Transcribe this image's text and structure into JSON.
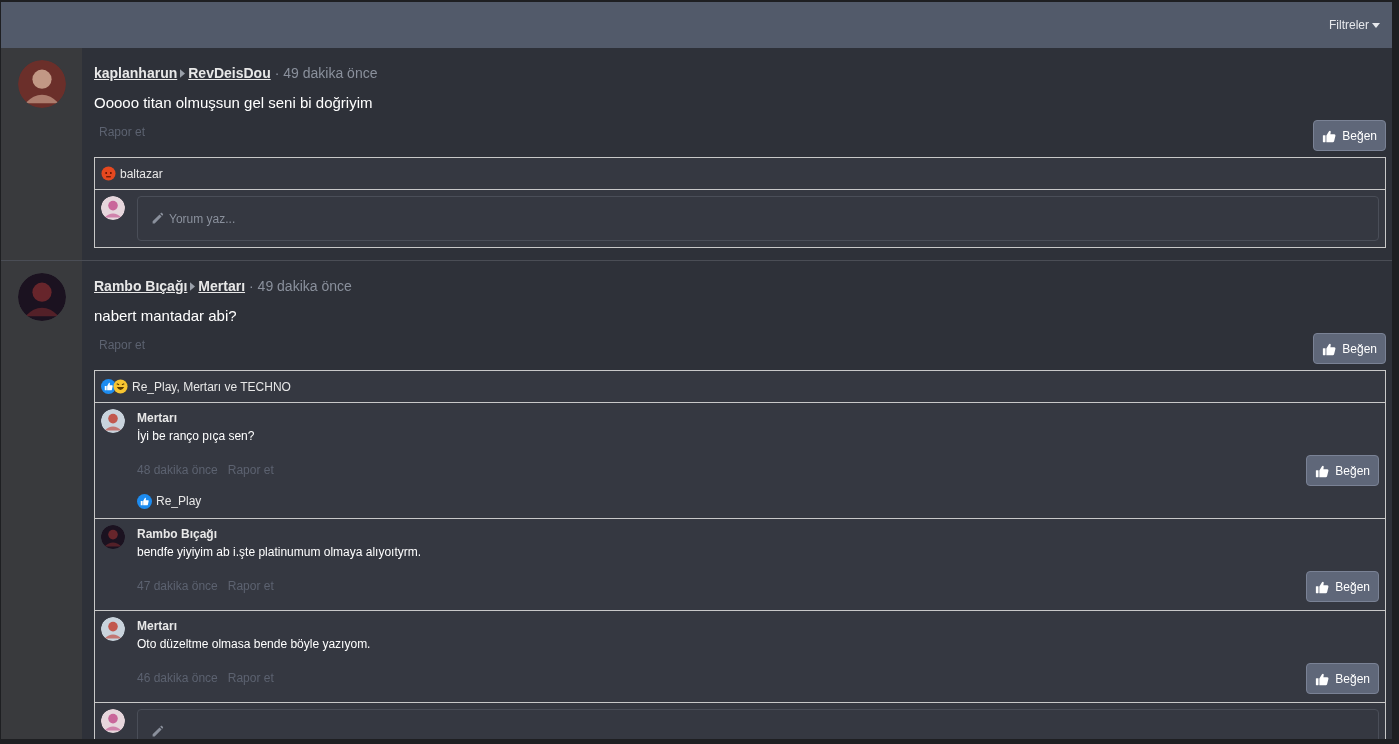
{
  "toolbar": {
    "filter_label": "Filtreler"
  },
  "posts": [
    {
      "author": "kaplanharun",
      "target": "RevDeisDou",
      "time": "· 49 dakika önce",
      "text": "Ooooo titan olmuşsun gel seni bi doğriyim",
      "report": "Rapor et",
      "like_label": "Beğen",
      "reactions": {
        "icons": [
          {
            "kind": "angry"
          }
        ],
        "names": "baltazar"
      },
      "composer_placeholder": "Yorum yaz..."
    },
    {
      "author": "Rambo Bıçağı",
      "target": "Mertarı",
      "time": "· 49 dakika önce",
      "text": "nabert mantadar abi?",
      "report": "Rapor et",
      "like_label": "Beğen",
      "reactions": {
        "icons": [
          {
            "kind": "like"
          },
          {
            "kind": "haha"
          }
        ],
        "names": "Re_Play, Mertarı ve TECHNO"
      },
      "replies": [
        {
          "author": "Mertarı",
          "text": "İyi be ranço pıça sen?",
          "time": "48 dakika önce",
          "report": "Rapor et",
          "like_label": "Beğen",
          "reactions": {
            "icons": [
              {
                "kind": "like"
              }
            ],
            "names": "Re_Play"
          }
        },
        {
          "author": "Rambo Bıçağı",
          "text": "bendfe yiyiyim ab i.şte platinumum olmaya alıyoıtyrm.",
          "time": "47 dakika önce",
          "report": "Rapor et",
          "like_label": "Beğen"
        },
        {
          "author": "Mertarı",
          "text": "Oto düzeltme olmasa bende böyle yazıyom.",
          "time": "46 dakika önce",
          "report": "Rapor et",
          "like_label": "Beğen"
        }
      ]
    }
  ]
}
